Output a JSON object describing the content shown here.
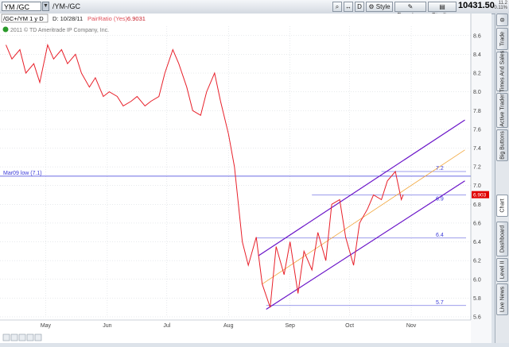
{
  "toolbar": {
    "symbol": "YM /GC",
    "symbol_label": "/YM-/GC",
    "buttons": [
      {
        "name": "zoom-button",
        "label": "⌕"
      },
      {
        "name": "pan-button",
        "label": "↔"
      },
      {
        "name": "period-button",
        "label": "D"
      },
      {
        "name": "style-button",
        "label": "⚙ Style"
      },
      {
        "name": "drawings-button",
        "label": "✎ Drawings"
      },
      {
        "name": "studies-button",
        "label": "▤ Studies"
      }
    ],
    "price": "10431.50",
    "price_change_1": "11.2",
    "price_change_2": "+0.11%"
  },
  "chart_header": {
    "symbol_line": "/GC+/YM 1 y D",
    "date": "D: 10/28/11",
    "study_name": "PairRatio (Yes)",
    "study_value": "6.9031",
    "copyright": "2011 © TD Ameritrade IP Company, Inc."
  },
  "annotations": {
    "hline_main_label": "Mar09 low (7.1)",
    "level_72": "7.2",
    "level_69": "6.9",
    "level_64": "6.4",
    "level_57": "5.7",
    "price_marker": "6.903"
  },
  "colors": {
    "ratio_line": "#e8202a",
    "channel": "#6a14c8",
    "midline": "#f2a63a",
    "hline": "#3a3ad8",
    "price_marker_bg": "#e00000"
  },
  "sidebar": {
    "tabs": [
      "Trade",
      "Times And Sales",
      "Active Trader",
      "Big Buttons",
      "Chart",
      "Dashboard",
      "Level II",
      "Live News"
    ],
    "active": "Chart"
  },
  "footer_icons": [
    "zoom-out-icon",
    "zoom-in-icon",
    "crosshair-icon",
    "settings-icon",
    "expand-icon"
  ],
  "chart_data": {
    "type": "line",
    "title": "",
    "series": [
      {
        "name": "PairRatio",
        "x": [
          "2011-04-11",
          "2011-04-14",
          "2011-04-18",
          "2011-04-21",
          "2011-04-25",
          "2011-04-28",
          "2011-05-02",
          "2011-05-05",
          "2011-05-09",
          "2011-05-12",
          "2011-05-16",
          "2011-05-19",
          "2011-05-23",
          "2011-05-26",
          "2011-05-30",
          "2011-06-02",
          "2011-06-06",
          "2011-06-09",
          "2011-06-13",
          "2011-06-16",
          "2011-06-20",
          "2011-06-23",
          "2011-06-27",
          "2011-06-30",
          "2011-07-04",
          "2011-07-07",
          "2011-07-11",
          "2011-07-14",
          "2011-07-18",
          "2011-07-21",
          "2011-07-25",
          "2011-07-28",
          "2011-08-01",
          "2011-08-04",
          "2011-08-08",
          "2011-08-11",
          "2011-08-15",
          "2011-08-18",
          "2011-08-22",
          "2011-08-25",
          "2011-08-29",
          "2011-09-01",
          "2011-09-05",
          "2011-09-08",
          "2011-09-12",
          "2011-09-15",
          "2011-09-19",
          "2011-09-22",
          "2011-09-26",
          "2011-09-29",
          "2011-10-03",
          "2011-10-06",
          "2011-10-10",
          "2011-10-13",
          "2011-10-17",
          "2011-10-20",
          "2011-10-24",
          "2011-10-27",
          "2011-10-28"
        ],
        "values": [
          8.5,
          8.35,
          8.45,
          8.2,
          8.3,
          8.1,
          8.5,
          8.35,
          8.45,
          8.3,
          8.4,
          8.2,
          8.05,
          8.15,
          7.95,
          8.0,
          7.95,
          7.85,
          7.9,
          7.95,
          7.85,
          7.9,
          7.95,
          8.2,
          8.45,
          8.3,
          8.05,
          7.8,
          7.75,
          8.0,
          8.2,
          7.9,
          7.55,
          7.2,
          6.4,
          6.15,
          6.45,
          5.95,
          5.7,
          6.35,
          6.05,
          6.4,
          5.85,
          6.3,
          6.1,
          6.5,
          6.2,
          6.8,
          6.85,
          6.45,
          6.15,
          6.6,
          6.75,
          6.9,
          6.85,
          7.05,
          7.15,
          6.85,
          6.9031
        ]
      },
      {
        "name": "Upper channel",
        "x": [
          "2011-08-16",
          "2011-11-28"
        ],
        "values": [
          6.25,
          7.7
        ]
      },
      {
        "name": "Lower channel",
        "x": [
          "2011-08-20",
          "2011-11-28"
        ],
        "values": [
          5.68,
          7.05
        ]
      },
      {
        "name": "Midline",
        "x": [
          "2011-08-18",
          "2011-11-28"
        ],
        "values": [
          5.95,
          7.38
        ]
      }
    ],
    "hlines": [
      {
        "value": 7.1,
        "label": "Mar09 low (7.1)",
        "from": "2011-04-01"
      },
      {
        "value": 7.15,
        "label": "7.2",
        "from": "2011-10-17"
      },
      {
        "value": 6.9,
        "label": "6.9",
        "from": "2011-09-12"
      },
      {
        "value": 6.44,
        "label": "6.4",
        "from": "2011-08-15"
      },
      {
        "value": 5.72,
        "label": "5.7",
        "from": "2011-08-20"
      }
    ],
    "xlabel": "",
    "ylabel": "",
    "xlim": [
      "2011-04-08",
      "2011-12-01"
    ],
    "ylim": [
      5.6,
      8.7
    ],
    "x_ticks": [
      {
        "date": "2011-05-01",
        "label": "May"
      },
      {
        "date": "2011-06-01",
        "label": "Jun"
      },
      {
        "date": "2011-07-01",
        "label": "Jul"
      },
      {
        "date": "2011-08-01",
        "label": "Aug"
      },
      {
        "date": "2011-09-01",
        "label": "Sep"
      },
      {
        "date": "2011-10-01",
        "label": "Oct"
      },
      {
        "date": "2011-11-01",
        "label": "Nov"
      }
    ],
    "y_ticks": [
      8.6,
      8.4,
      8.2,
      8.0,
      7.8,
      7.6,
      7.4,
      7.2,
      7.0,
      6.8,
      6.6,
      6.4,
      6.2,
      6.0,
      5.8,
      5.6
    ],
    "grid": true
  }
}
